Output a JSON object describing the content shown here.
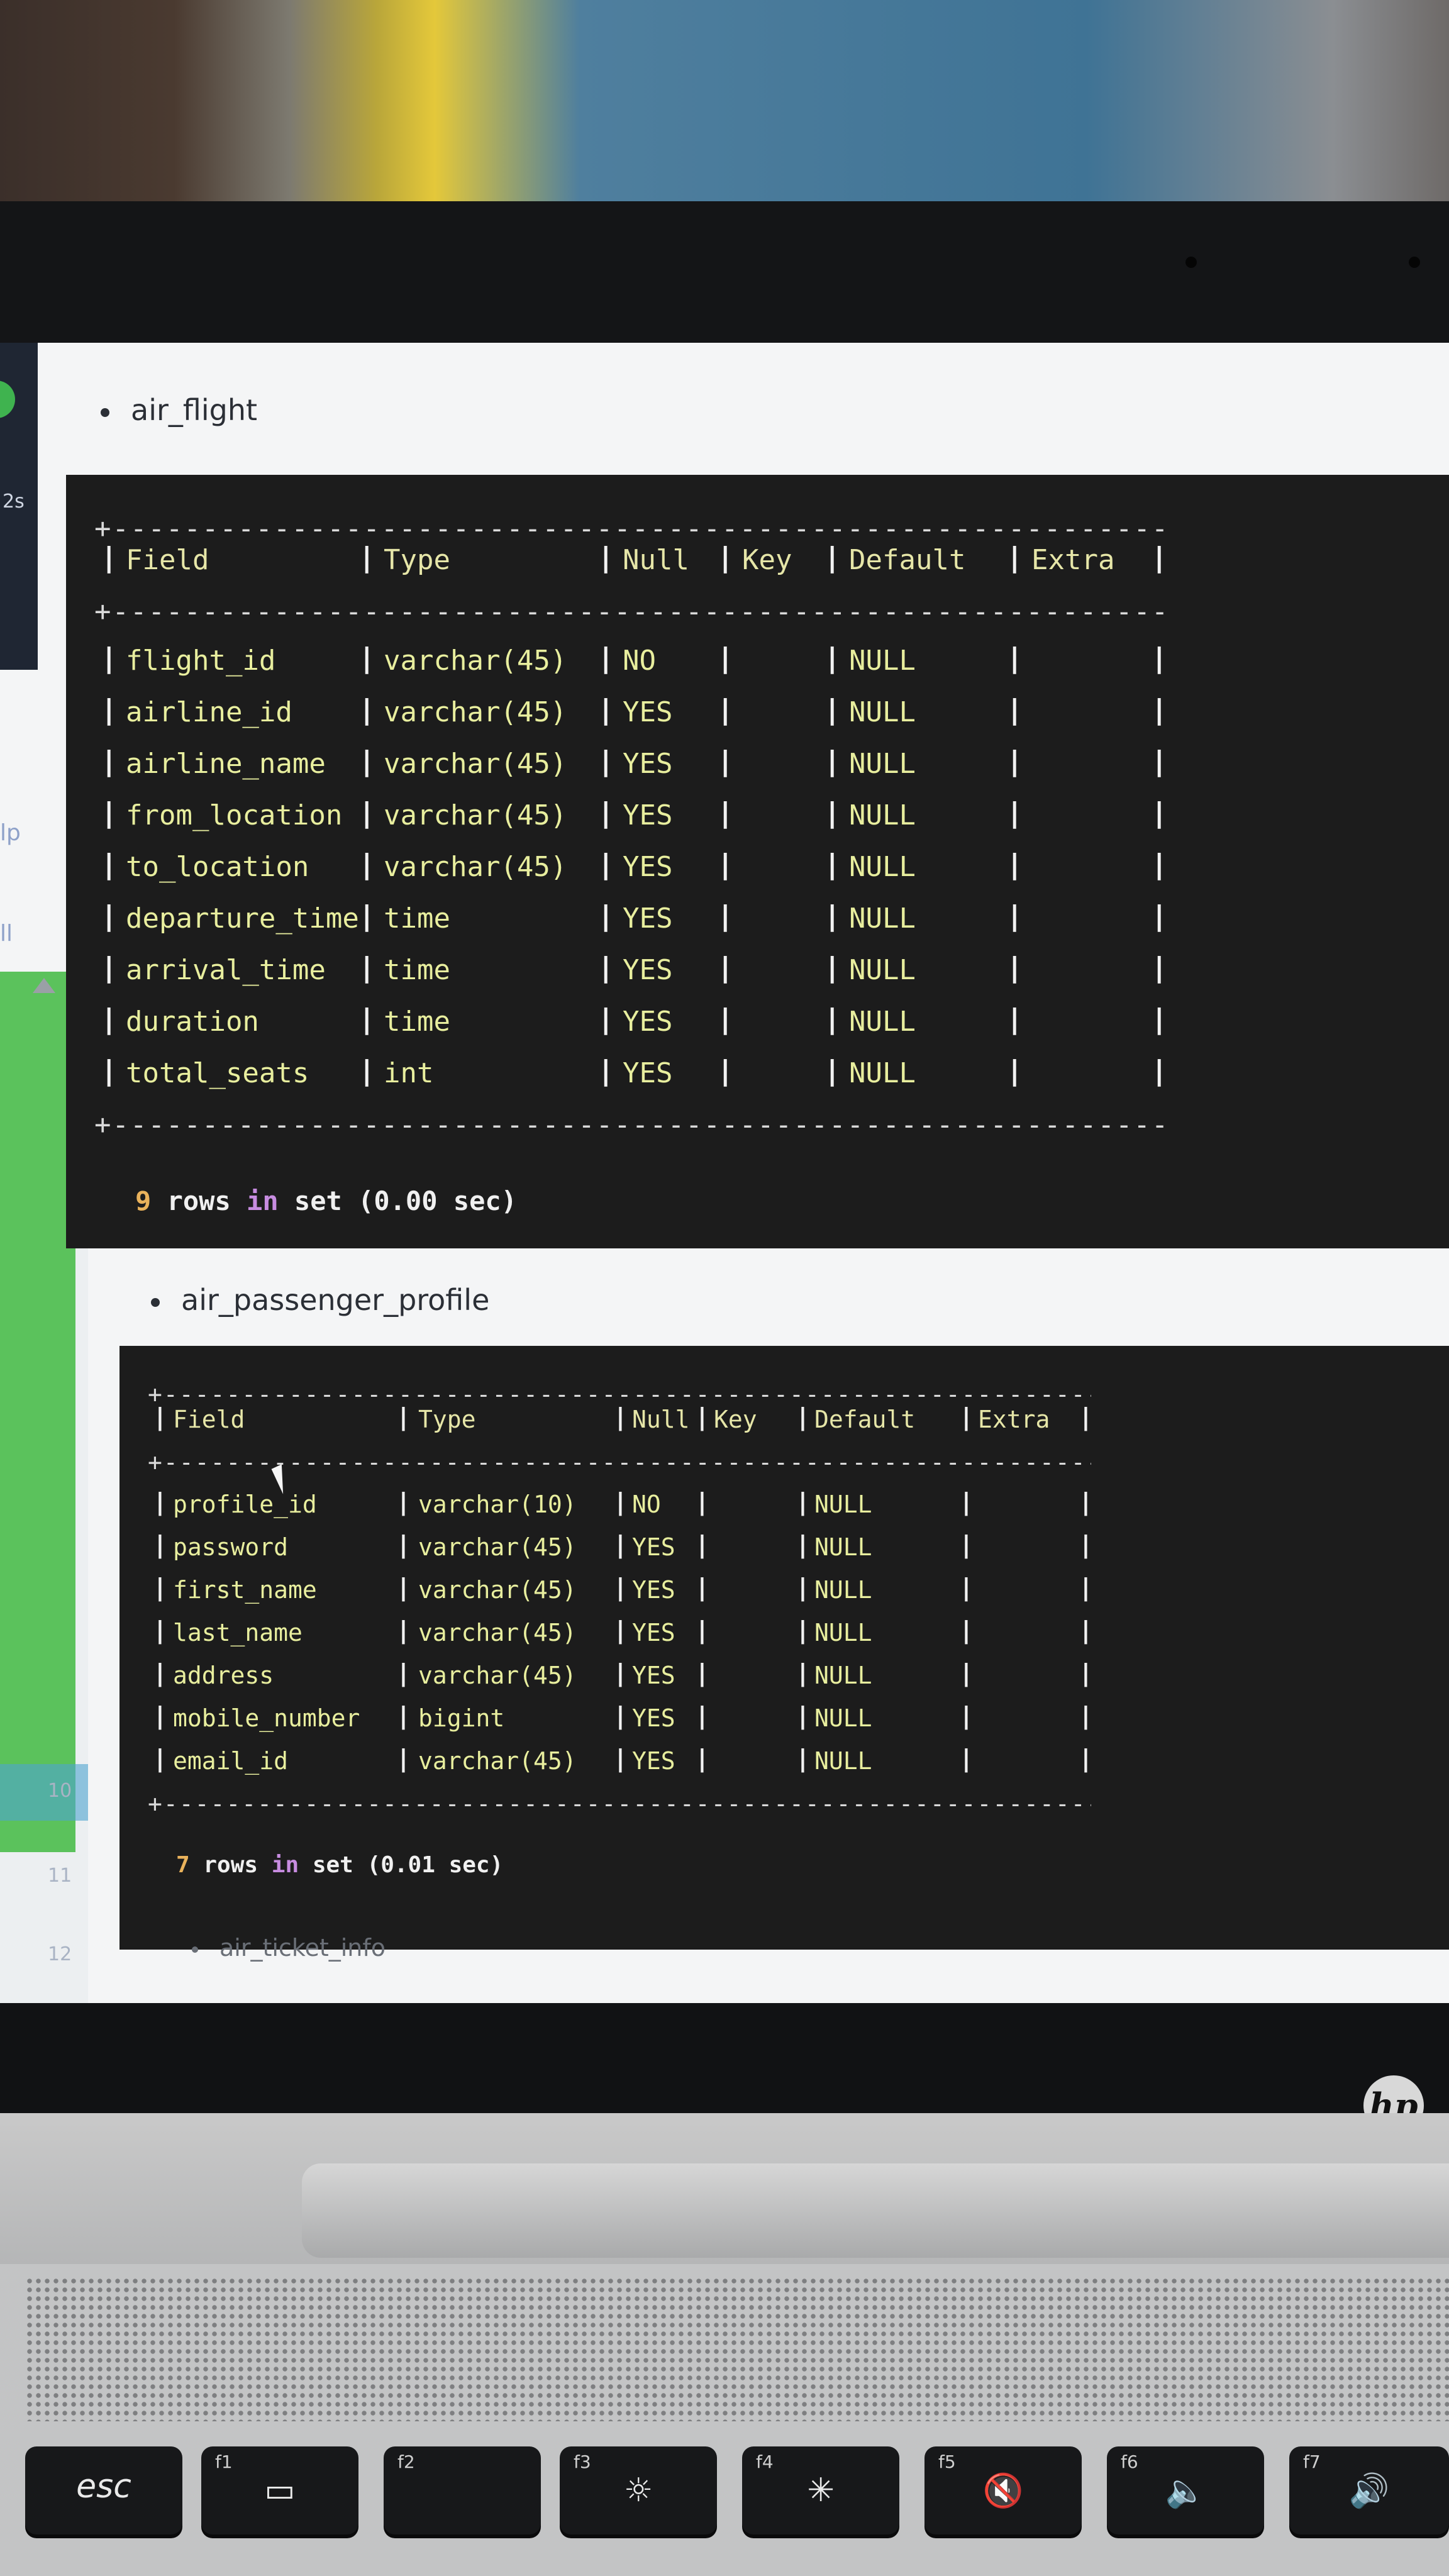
{
  "sidebar": {
    "partial_text": "2s",
    "labels": [
      "lp",
      "ll"
    ],
    "line_numbers": [
      "10",
      "11",
      "12"
    ]
  },
  "sections": [
    {
      "title": "air_flight",
      "columns": [
        "Field",
        "Type",
        "Null",
        "Key",
        "Default",
        "Extra"
      ],
      "rows": [
        [
          "flight_id",
          "varchar(45)",
          "NO",
          "",
          "NULL",
          ""
        ],
        [
          "airline_id",
          "varchar(45)",
          "YES",
          "",
          "NULL",
          ""
        ],
        [
          "airline_name",
          "varchar(45)",
          "YES",
          "",
          "NULL",
          ""
        ],
        [
          "from_location",
          "varchar(45)",
          "YES",
          "",
          "NULL",
          ""
        ],
        [
          "to_location",
          "varchar(45)",
          "YES",
          "",
          "NULL",
          ""
        ],
        [
          "departure_time",
          "time",
          "YES",
          "",
          "NULL",
          ""
        ],
        [
          "arrival_time",
          "time",
          "YES",
          "",
          "NULL",
          ""
        ],
        [
          "duration",
          "time",
          "YES",
          "",
          "NULL",
          ""
        ],
        [
          "total_seats",
          "int",
          "YES",
          "",
          "NULL",
          ""
        ]
      ],
      "footer": {
        "count": "9",
        "rows": "rows",
        "in": "in",
        "set": "set",
        "time": "(0.00 sec)"
      }
    },
    {
      "title": "air_passenger_profile",
      "columns": [
        "Field",
        "Type",
        "Null",
        "Key",
        "Default",
        "Extra"
      ],
      "rows": [
        [
          "profile_id",
          "varchar(10)",
          "NO",
          "",
          "NULL",
          ""
        ],
        [
          "password",
          "varchar(45)",
          "YES",
          "",
          "NULL",
          ""
        ],
        [
          "first_name",
          "varchar(45)",
          "YES",
          "",
          "NULL",
          ""
        ],
        [
          "last_name",
          "varchar(45)",
          "YES",
          "",
          "NULL",
          ""
        ],
        [
          "address",
          "varchar(45)",
          "YES",
          "",
          "NULL",
          ""
        ],
        [
          "mobile_number",
          "bigint",
          "YES",
          "",
          "NULL",
          ""
        ],
        [
          "email_id",
          "varchar(45)",
          "YES",
          "",
          "NULL",
          ""
        ]
      ],
      "footer": {
        "count": "7",
        "rows": "rows",
        "in": "in",
        "set": "set",
        "time": "(0.01 sec)"
      }
    },
    {
      "title": "air_ticket_info"
    }
  ],
  "keyboard": {
    "keys": [
      {
        "name": "esc",
        "fn": "",
        "glyph": "esc"
      },
      {
        "name": "f1",
        "fn": "f1",
        "glyph": "▭"
      },
      {
        "name": "f2",
        "fn": "f2",
        "glyph": ""
      },
      {
        "name": "f3",
        "fn": "f3",
        "glyph": "☼"
      },
      {
        "name": "f4",
        "fn": "f4",
        "glyph": "✳"
      },
      {
        "name": "f5",
        "fn": "f5",
        "glyph": "🔇"
      },
      {
        "name": "f6",
        "fn": "f6",
        "glyph": "🔈"
      },
      {
        "name": "f7",
        "fn": "f7",
        "glyph": "🔊"
      }
    ],
    "brand": "hp"
  },
  "colors": {
    "terminal_bg": "#1c1c1c",
    "terminal_text": "#e8ee9e",
    "accent_green": "#5bc25c"
  }
}
